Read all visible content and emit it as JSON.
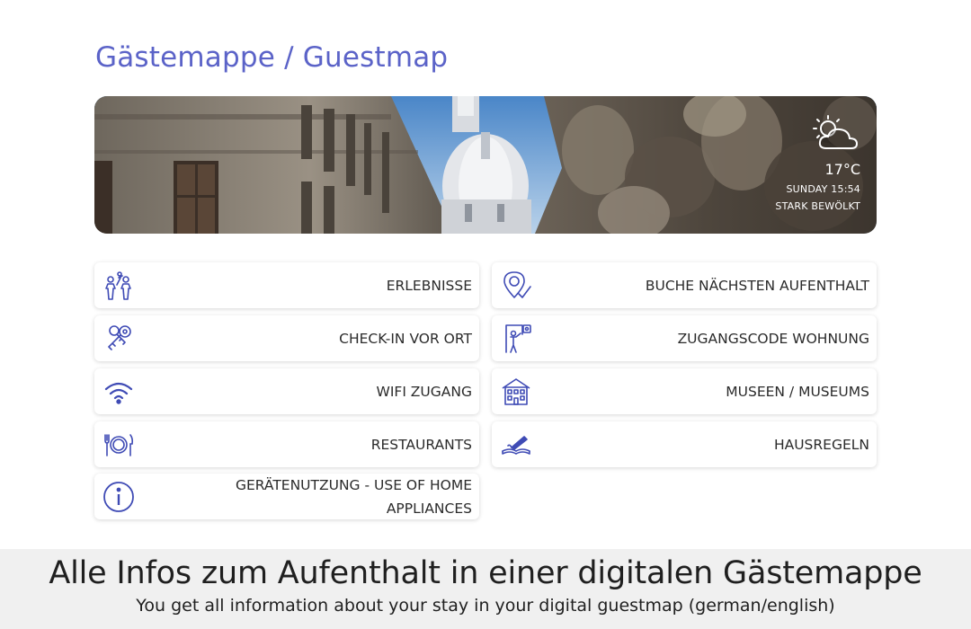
{
  "page": {
    "title": "Gästemappe / Guestmap"
  },
  "weather": {
    "icon": "partly-cloudy-icon",
    "temperature": "17°C",
    "day_time": "SUNDAY 15:54",
    "condition": "STARK BEWÖLKT"
  },
  "menu": {
    "left": [
      {
        "label": "ERLEBNISSE",
        "icon": "people-experience-icon"
      },
      {
        "label": "CHECK-IN VOR ORT",
        "icon": "keys-icon"
      },
      {
        "label": "WIFI ZUGANG",
        "icon": "wifi-icon"
      },
      {
        "label": "RESTAURANTS",
        "icon": "plate-cutlery-icon"
      },
      {
        "label": "GERÄTENUTZUNG - USE OF HOME APPLIANCES",
        "icon": "info-icon"
      }
    ],
    "right": [
      {
        "label": "BUCHE NÄCHSTEN AUFENTHALT",
        "icon": "location-check-icon"
      },
      {
        "label": "ZUGANGSCODE WOHNUNG",
        "icon": "door-code-icon"
      },
      {
        "label": "MUSEEN / MUSEUMS",
        "icon": "museum-building-icon"
      },
      {
        "label": "HAUSREGELN",
        "icon": "book-pen-icon"
      }
    ]
  },
  "footer": {
    "headline": "Alle Infos zum Aufenthalt in einer digitalen Gästemappe",
    "subline": "You get all information about your stay in your digital guestmap (german/english)"
  },
  "colors": {
    "accent": "#5b63c8",
    "icon": "#3f4bb5"
  }
}
